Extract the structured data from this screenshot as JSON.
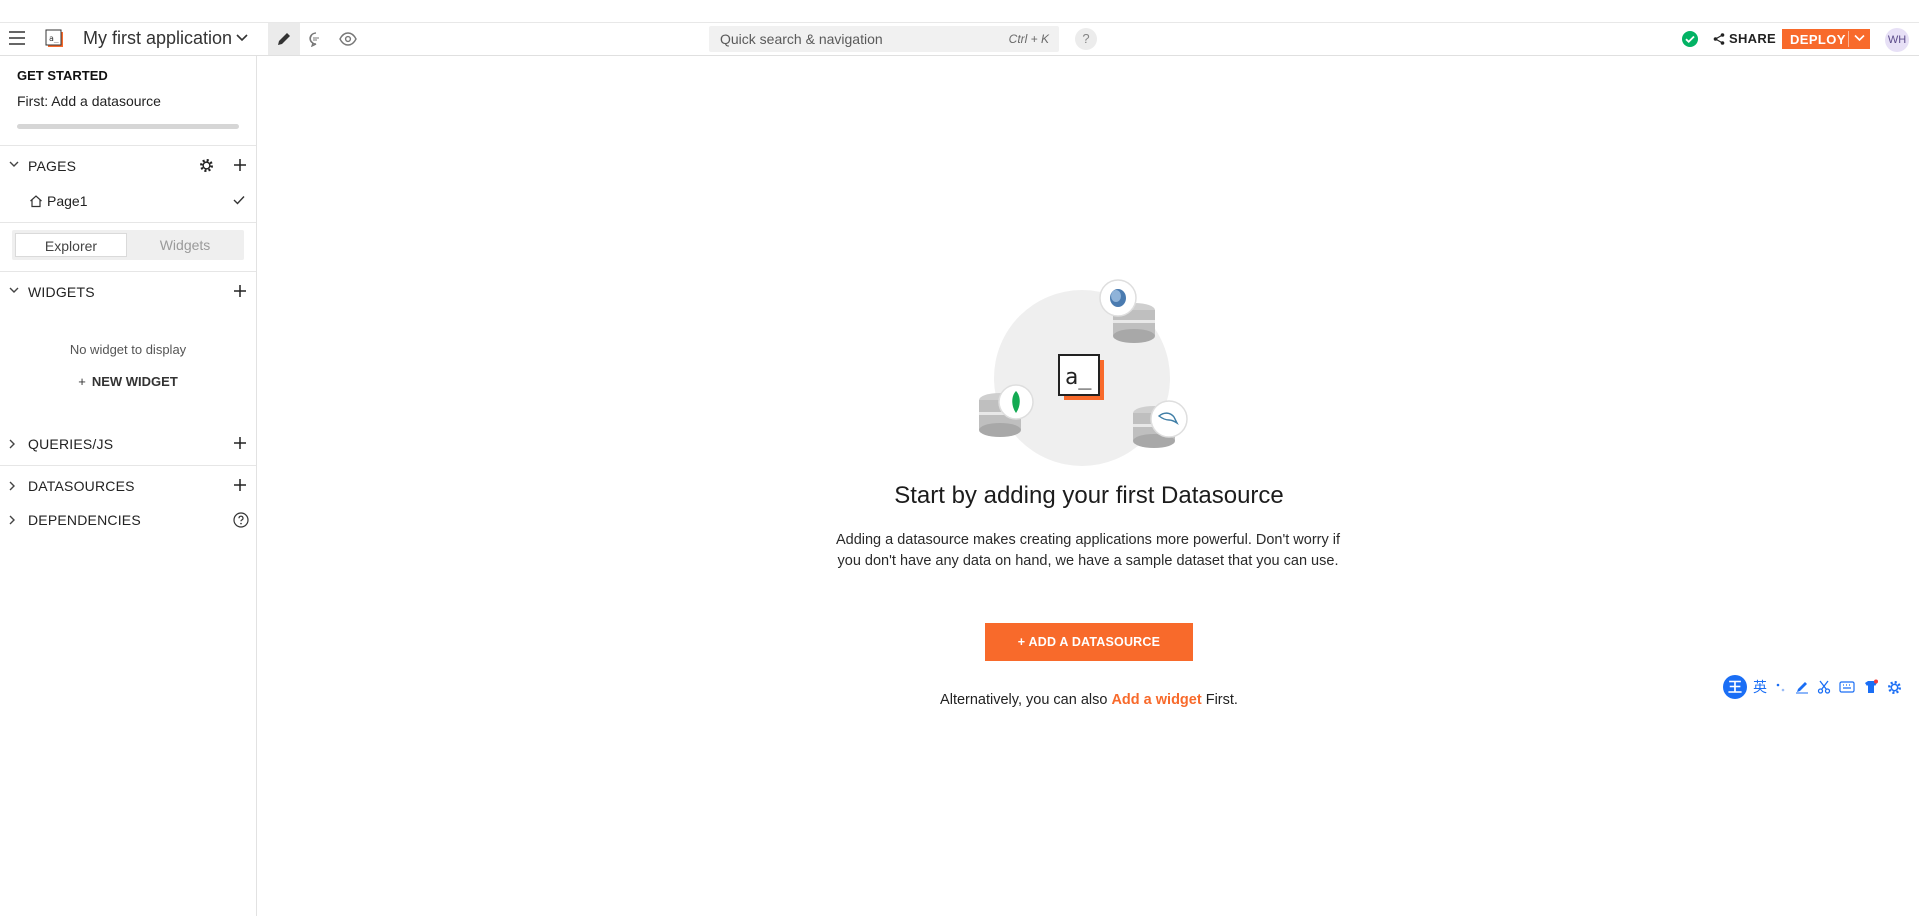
{
  "header": {
    "app_name": "My first application",
    "search_placeholder": "Quick search & navigation",
    "search_shortcut": "Ctrl + K",
    "help_label": "?",
    "share_label": "SHARE",
    "deploy_label": "DEPLOY",
    "avatar_initials": "WH"
  },
  "sidebar": {
    "get_started": {
      "title": "GET STARTED",
      "subtitle": "First: Add a datasource",
      "progress": 0
    },
    "pages": {
      "label": "PAGES",
      "items": [
        {
          "label": "Page1"
        }
      ]
    },
    "tabs": {
      "explorer": "Explorer",
      "widgets": "Widgets"
    },
    "widgets": {
      "label": "WIDGETS",
      "empty_message": "No widget to display",
      "new_widget_label": "NEW WIDGET",
      "new_widget_plus": "+"
    },
    "queries": {
      "label": "QUERIES/JS"
    },
    "datasources": {
      "label": "DATASOURCES"
    },
    "dependencies": {
      "label": "DEPENDENCIES"
    }
  },
  "main": {
    "logo_text": "a_",
    "title": "Start by adding your first Datasource",
    "description": "Adding a datasource makes creating applications more powerful. Don't worry if you don't have any data on hand, we have a sample dataset that you can use.",
    "cta_label": "+ ADD A DATASOURCE",
    "alt_prefix": "Alternatively, you can also",
    "alt_link": "Add a widget",
    "alt_suffix": "First."
  },
  "ime": {
    "logo": "王",
    "lang": "英"
  },
  "colors": {
    "accent": "#f86a2b",
    "success": "#03b365",
    "ime_blue": "#1a6ef5"
  }
}
